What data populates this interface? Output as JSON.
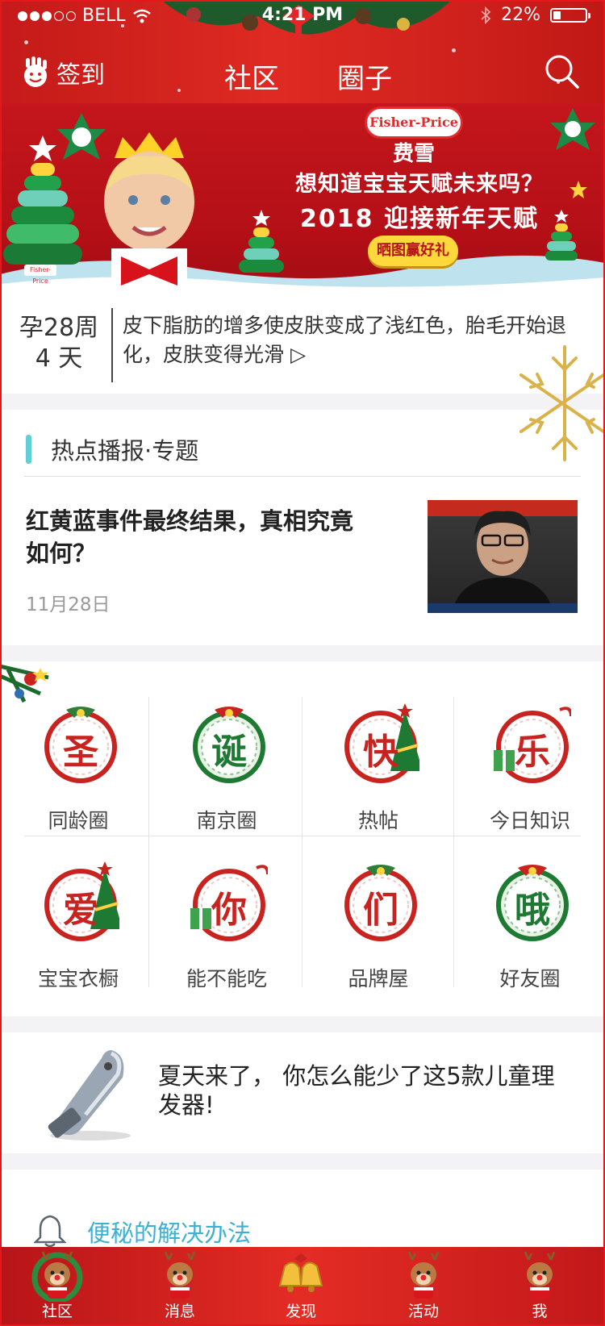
{
  "status_bar": {
    "carrier": "BELL",
    "time": "4:21 PM",
    "battery": "22%"
  },
  "nav": {
    "checkin": "签到",
    "tabs": [
      {
        "label": "社区",
        "active": true
      },
      {
        "label": "圈子",
        "active": false
      }
    ]
  },
  "banner": {
    "brand_en": "Fisher-Price",
    "brand_cn": "费雪",
    "headline": "想知道宝宝天赋未来吗？",
    "subheadline": "2018 迎接新年天赋",
    "button": "晒图赢好礼",
    "small_logo": "Fisher-Price"
  },
  "pregnancy": {
    "week_line": "孕28周",
    "day_line": "4 天",
    "description": "皮下脂肪的增多使皮肤变成了浅红色，胎毛开始退化，皮肤变得光滑 ▷"
  },
  "hot": {
    "section_title": "热点播报·专题",
    "article_title": "红黄蓝事件最终结果，真相究竟如何？",
    "article_date": "11月28日"
  },
  "grid": [
    {
      "badge": "圣",
      "label": "同龄圈",
      "style": "wreath-red"
    },
    {
      "badge": "诞",
      "label": "南京圈",
      "style": "wreath-green"
    },
    {
      "badge": "快",
      "label": "热帖",
      "style": "tree"
    },
    {
      "badge": "乐",
      "label": "今日知识",
      "style": "gift"
    },
    {
      "badge": "爱",
      "label": "宝宝衣橱",
      "style": "tree"
    },
    {
      "badge": "你",
      "label": "能不能吃",
      "style": "gift"
    },
    {
      "badge": "们",
      "label": "品牌屋",
      "style": "wreath-red"
    },
    {
      "badge": "哦",
      "label": "好友圈",
      "style": "wreath-green"
    }
  ],
  "article": {
    "title": "夏天来了， 你怎么能少了这5款儿童理发器!"
  },
  "notice": {
    "text": "便秘的解决办法"
  },
  "tabbar": [
    {
      "label": "社区",
      "icon": "reindeer-wreath-icon"
    },
    {
      "label": "消息",
      "icon": "reindeer-icon"
    },
    {
      "label": "发现",
      "icon": "bells-icon"
    },
    {
      "label": "活动",
      "icon": "reindeer-icon"
    },
    {
      "label": "我",
      "icon": "reindeer-icon"
    }
  ],
  "colors": {
    "header_red": "#d3231e",
    "accent_teal": "#62cfd6",
    "notice_blue": "#3cb1d3",
    "badge_red": "#c9231f",
    "badge_green": "#1e7a32"
  }
}
